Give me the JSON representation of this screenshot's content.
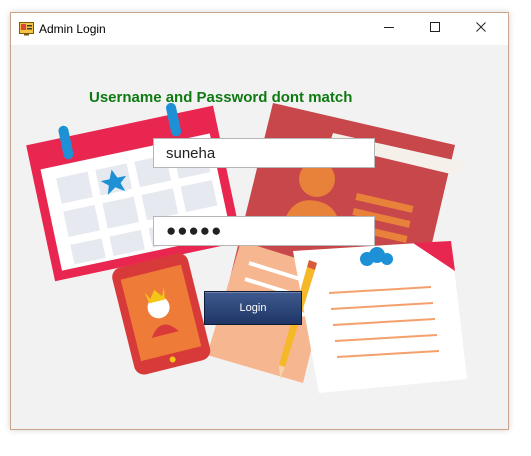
{
  "window": {
    "title": "Admin Login",
    "controls": {
      "minimize": "minimize",
      "maximize": "maximize",
      "close": "close"
    }
  },
  "form": {
    "error_message": "Username and Password dont match",
    "username_value": "suneha",
    "password_mask": "●●●●●",
    "login_label": "Login"
  },
  "colors": {
    "error_text": "#0f7a12",
    "button": "#2b4577",
    "background": "#f2f2f2"
  }
}
